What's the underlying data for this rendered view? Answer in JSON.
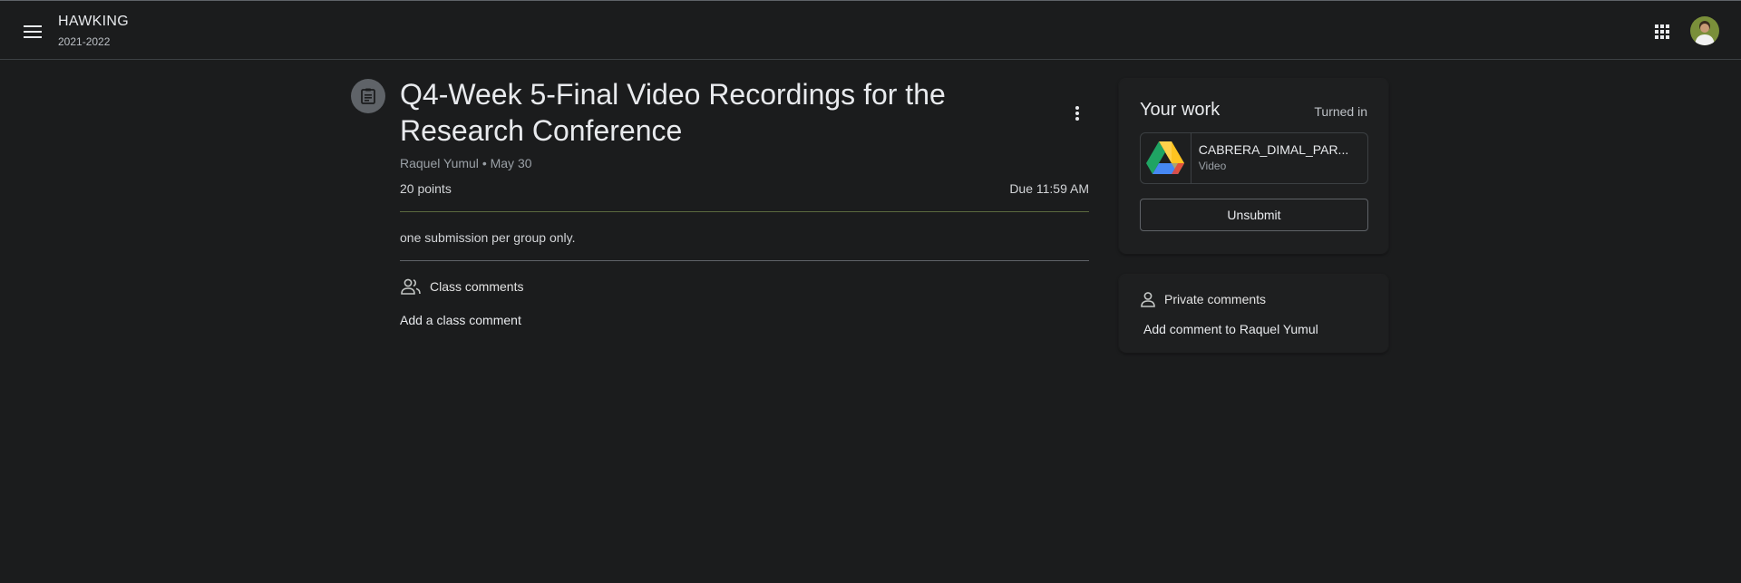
{
  "header": {
    "class_name": "HAWKING",
    "class_section": "2021-2022",
    "menu_icon": "hamburger-menu-icon",
    "apps_icon": "google-apps-grid-icon",
    "avatar_icon": "user-avatar"
  },
  "assignment": {
    "icon": "assignment-icon",
    "title": "Q4-Week 5-Final Video Recordings for the Research Conference",
    "teacher": "Raquel Yumul",
    "separator": "•",
    "posted_date": "May 30",
    "points": "20 points",
    "due": "Due 11:59 AM",
    "instructions": "one submission per group only.",
    "more_icon": "more-vert-icon"
  },
  "class_comments": {
    "icon": "people-icon",
    "label": "Class comments",
    "add_label": "Add a class comment"
  },
  "your_work": {
    "title": "Your work",
    "status": "Turned in",
    "attachment": {
      "icon": "google-drive-icon",
      "name": "CABRERA_DIMAL_PAR...",
      "type": "Video"
    },
    "unsubmit_label": "Unsubmit"
  },
  "private_comments": {
    "icon": "person-icon",
    "label": "Private comments",
    "add_label": "Add comment to Raquel Yumul"
  },
  "colors": {
    "background": "#1b1c1d",
    "accent_divider": "#5b6a3f",
    "drive_green": "#1fa463",
    "drive_yellow": "#ffd04b",
    "drive_blue": "#4688f4"
  }
}
